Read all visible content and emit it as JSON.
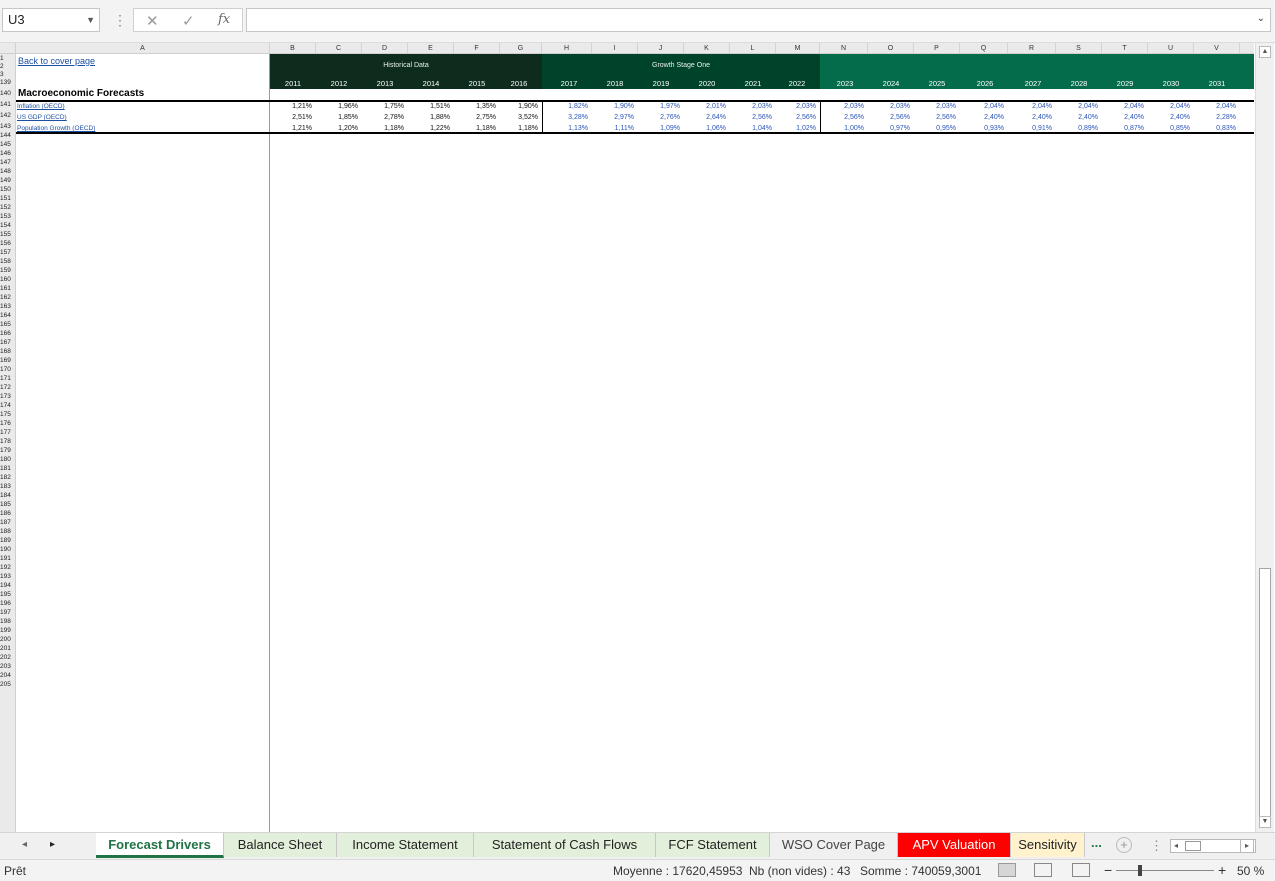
{
  "formula_bar": {
    "name_box": "U3",
    "cancel_icon": "✕",
    "enter_icon": "✓",
    "fx": "fx",
    "formula": ""
  },
  "columns": [
    "A",
    "B",
    "C",
    "D",
    "E",
    "F",
    "G",
    "H",
    "I",
    "J",
    "K",
    "L",
    "M",
    "N",
    "O",
    "P",
    "Q",
    "R",
    "S",
    "T",
    "U",
    "V"
  ],
  "rows": [
    "1",
    "2",
    "3",
    "139",
    "140",
    "141",
    "142",
    "143",
    "144",
    "145",
    "146",
    "147",
    "148",
    "149",
    "150",
    "151",
    "152",
    "153",
    "154",
    "155",
    "156",
    "157",
    "158",
    "159",
    "160",
    "161",
    "162",
    "163",
    "164",
    "165",
    "166",
    "167",
    "168",
    "169",
    "170",
    "171",
    "172",
    "173",
    "174",
    "175",
    "176",
    "177",
    "178",
    "179",
    "180",
    "181",
    "182",
    "183",
    "184",
    "185",
    "186",
    "187",
    "188",
    "189",
    "190",
    "191",
    "192",
    "193",
    "194",
    "195",
    "196",
    "197",
    "198",
    "199",
    "200",
    "201",
    "202",
    "203",
    "204",
    "205"
  ],
  "sheet": {
    "back_link": "Back to cover page",
    "hist_label": "Historical Data",
    "growth_label": "Growth Stage One",
    "section_title": "Macroeconomic Forecasts",
    "years": [
      "2011",
      "2012",
      "2013",
      "2014",
      "2015",
      "2016",
      "2017",
      "2018",
      "2019",
      "2020",
      "2021",
      "2022",
      "2023",
      "2024",
      "2025",
      "2026",
      "2027",
      "2028",
      "2029",
      "2030",
      "2031"
    ],
    "data_rows": [
      {
        "label": "Inflation (OECD)",
        "values": [
          "1,21%",
          "1,96%",
          "1,75%",
          "1,51%",
          "1,35%",
          "1,90%",
          "1,82%",
          "1,90%",
          "1,97%",
          "2,01%",
          "2,03%",
          "2,03%",
          "2,03%",
          "2,03%",
          "2,03%",
          "2,04%",
          "2,04%",
          "2,04%",
          "2,04%",
          "2,04%",
          "2,04%"
        ]
      },
      {
        "label": "US GDP (OECD)",
        "values": [
          "2,51%",
          "1,85%",
          "2,78%",
          "1,88%",
          "2,75%",
          "3,52%",
          "3,28%",
          "2,97%",
          "2,76%",
          "2,64%",
          "2,56%",
          "2,56%",
          "2,56%",
          "2,56%",
          "2,56%",
          "2,40%",
          "2,40%",
          "2,40%",
          "2,40%",
          "2,40%",
          "2,28%"
        ]
      },
      {
        "label": "Population Growth (OECD)",
        "values": [
          "1,21%",
          "1,20%",
          "1,18%",
          "1,22%",
          "1,18%",
          "1,18%",
          "1,13%",
          "1,11%",
          "1,09%",
          "1,06%",
          "1,04%",
          "1,02%",
          "1,00%",
          "0,97%",
          "0,95%",
          "0,93%",
          "0,91%",
          "0,89%",
          "0,87%",
          "0,85%",
          "0,83%"
        ]
      }
    ]
  },
  "tabs": [
    {
      "label": "Forecast Drivers",
      "bg": "#ffffff",
      "fg": "#217346",
      "active": true
    },
    {
      "label": "Balance Sheet",
      "bg": "#e2efda",
      "fg": "#222222",
      "active": false
    },
    {
      "label": "Income Statement",
      "bg": "#e2efda",
      "fg": "#222222",
      "active": false
    },
    {
      "label": "Statement of Cash Flows",
      "bg": "#e2efda",
      "fg": "#222222",
      "active": false
    },
    {
      "label": "FCF Statement",
      "bg": "#e2efda",
      "fg": "#222222",
      "active": false
    },
    {
      "label": "WSO Cover Page",
      "bg": "#f0f0f0",
      "fg": "#444444",
      "active": false
    },
    {
      "label": "APV Valuation",
      "bg": "#ff0000",
      "fg": "#ffffff",
      "active": false
    },
    {
      "label": "Sensitivity",
      "bg": "#fff2cc",
      "fg": "#222222",
      "active": false
    }
  ],
  "tab_more": "...",
  "status": {
    "ready": "Prêt",
    "average": "Moyenne : 17620,45953",
    "count": "Nb (non vides) : 43",
    "sum": "Somme : 740059,3001",
    "zoom": "50 %",
    "zoom_minus": "−",
    "zoom_plus": "+"
  }
}
